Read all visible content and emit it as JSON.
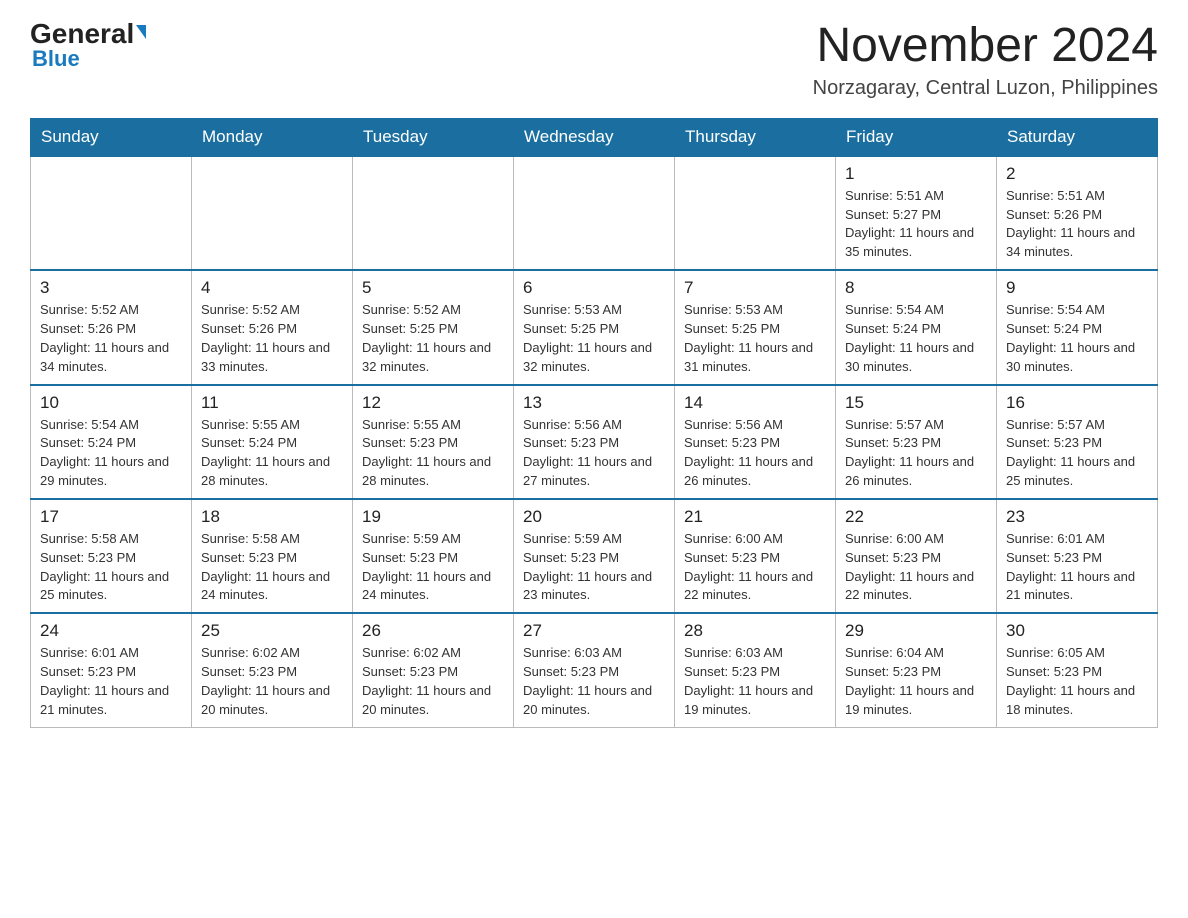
{
  "header": {
    "logo_general": "General",
    "logo_blue": "Blue",
    "month_title": "November 2024",
    "location": "Norzagaray, Central Luzon, Philippines"
  },
  "days_of_week": [
    "Sunday",
    "Monday",
    "Tuesday",
    "Wednesday",
    "Thursday",
    "Friday",
    "Saturday"
  ],
  "weeks": [
    [
      {
        "day": "",
        "info": ""
      },
      {
        "day": "",
        "info": ""
      },
      {
        "day": "",
        "info": ""
      },
      {
        "day": "",
        "info": ""
      },
      {
        "day": "",
        "info": ""
      },
      {
        "day": "1",
        "info": "Sunrise: 5:51 AM\nSunset: 5:27 PM\nDaylight: 11 hours and 35 minutes."
      },
      {
        "day": "2",
        "info": "Sunrise: 5:51 AM\nSunset: 5:26 PM\nDaylight: 11 hours and 34 minutes."
      }
    ],
    [
      {
        "day": "3",
        "info": "Sunrise: 5:52 AM\nSunset: 5:26 PM\nDaylight: 11 hours and 34 minutes."
      },
      {
        "day": "4",
        "info": "Sunrise: 5:52 AM\nSunset: 5:26 PM\nDaylight: 11 hours and 33 minutes."
      },
      {
        "day": "5",
        "info": "Sunrise: 5:52 AM\nSunset: 5:25 PM\nDaylight: 11 hours and 32 minutes."
      },
      {
        "day": "6",
        "info": "Sunrise: 5:53 AM\nSunset: 5:25 PM\nDaylight: 11 hours and 32 minutes."
      },
      {
        "day": "7",
        "info": "Sunrise: 5:53 AM\nSunset: 5:25 PM\nDaylight: 11 hours and 31 minutes."
      },
      {
        "day": "8",
        "info": "Sunrise: 5:54 AM\nSunset: 5:24 PM\nDaylight: 11 hours and 30 minutes."
      },
      {
        "day": "9",
        "info": "Sunrise: 5:54 AM\nSunset: 5:24 PM\nDaylight: 11 hours and 30 minutes."
      }
    ],
    [
      {
        "day": "10",
        "info": "Sunrise: 5:54 AM\nSunset: 5:24 PM\nDaylight: 11 hours and 29 minutes."
      },
      {
        "day": "11",
        "info": "Sunrise: 5:55 AM\nSunset: 5:24 PM\nDaylight: 11 hours and 28 minutes."
      },
      {
        "day": "12",
        "info": "Sunrise: 5:55 AM\nSunset: 5:23 PM\nDaylight: 11 hours and 28 minutes."
      },
      {
        "day": "13",
        "info": "Sunrise: 5:56 AM\nSunset: 5:23 PM\nDaylight: 11 hours and 27 minutes."
      },
      {
        "day": "14",
        "info": "Sunrise: 5:56 AM\nSunset: 5:23 PM\nDaylight: 11 hours and 26 minutes."
      },
      {
        "day": "15",
        "info": "Sunrise: 5:57 AM\nSunset: 5:23 PM\nDaylight: 11 hours and 26 minutes."
      },
      {
        "day": "16",
        "info": "Sunrise: 5:57 AM\nSunset: 5:23 PM\nDaylight: 11 hours and 25 minutes."
      }
    ],
    [
      {
        "day": "17",
        "info": "Sunrise: 5:58 AM\nSunset: 5:23 PM\nDaylight: 11 hours and 25 minutes."
      },
      {
        "day": "18",
        "info": "Sunrise: 5:58 AM\nSunset: 5:23 PM\nDaylight: 11 hours and 24 minutes."
      },
      {
        "day": "19",
        "info": "Sunrise: 5:59 AM\nSunset: 5:23 PM\nDaylight: 11 hours and 24 minutes."
      },
      {
        "day": "20",
        "info": "Sunrise: 5:59 AM\nSunset: 5:23 PM\nDaylight: 11 hours and 23 minutes."
      },
      {
        "day": "21",
        "info": "Sunrise: 6:00 AM\nSunset: 5:23 PM\nDaylight: 11 hours and 22 minutes."
      },
      {
        "day": "22",
        "info": "Sunrise: 6:00 AM\nSunset: 5:23 PM\nDaylight: 11 hours and 22 minutes."
      },
      {
        "day": "23",
        "info": "Sunrise: 6:01 AM\nSunset: 5:23 PM\nDaylight: 11 hours and 21 minutes."
      }
    ],
    [
      {
        "day": "24",
        "info": "Sunrise: 6:01 AM\nSunset: 5:23 PM\nDaylight: 11 hours and 21 minutes."
      },
      {
        "day": "25",
        "info": "Sunrise: 6:02 AM\nSunset: 5:23 PM\nDaylight: 11 hours and 20 minutes."
      },
      {
        "day": "26",
        "info": "Sunrise: 6:02 AM\nSunset: 5:23 PM\nDaylight: 11 hours and 20 minutes."
      },
      {
        "day": "27",
        "info": "Sunrise: 6:03 AM\nSunset: 5:23 PM\nDaylight: 11 hours and 20 minutes."
      },
      {
        "day": "28",
        "info": "Sunrise: 6:03 AM\nSunset: 5:23 PM\nDaylight: 11 hours and 19 minutes."
      },
      {
        "day": "29",
        "info": "Sunrise: 6:04 AM\nSunset: 5:23 PM\nDaylight: 11 hours and 19 minutes."
      },
      {
        "day": "30",
        "info": "Sunrise: 6:05 AM\nSunset: 5:23 PM\nDaylight: 11 hours and 18 minutes."
      }
    ]
  ]
}
